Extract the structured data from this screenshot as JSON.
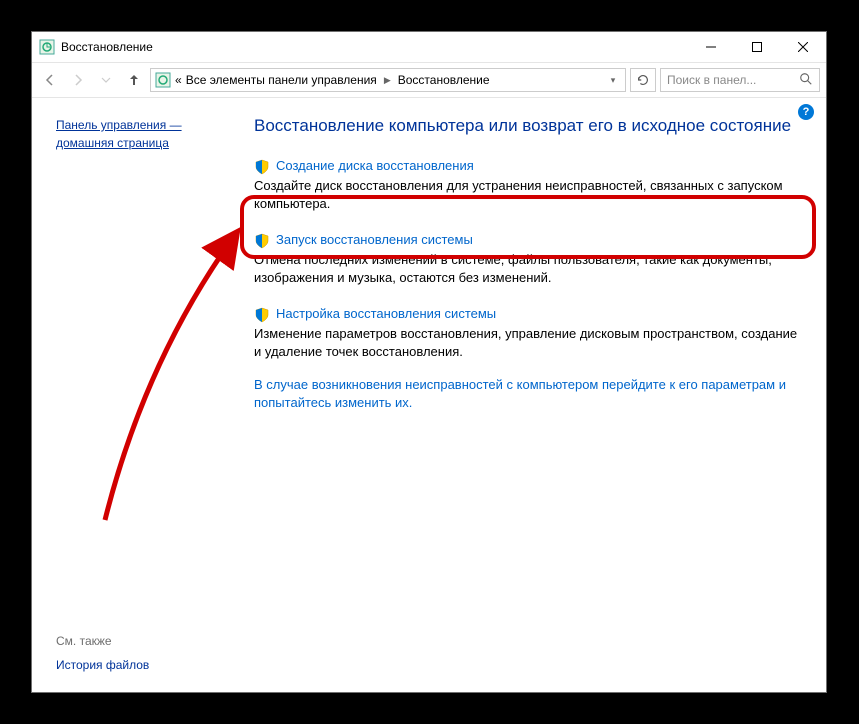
{
  "window": {
    "title": "Восстановление"
  },
  "address": {
    "prefix": "«",
    "seg1": "Все элементы панели управления",
    "seg2": "Восстановление"
  },
  "search": {
    "placeholder": "Поиск в панел..."
  },
  "sidebar": {
    "home_line1": "Панель управления —",
    "home_line2": "домашняя страница",
    "see_also": "См. также",
    "file_history": "История файлов"
  },
  "main": {
    "heading": "Восстановление компьютера или возврат его в исходное состояние",
    "options": [
      {
        "title": "Создание диска восстановления",
        "desc": "Создайте диск восстановления для устранения неисправностей, связанных с запуском компьютера."
      },
      {
        "title": "Запуск восстановления системы",
        "desc": "Отмена последних изменений в системе; файлы пользователя, такие как документы, изображения и музыка, остаются без изменений."
      },
      {
        "title": "Настройка восстановления системы",
        "desc": "Изменение параметров восстановления, управление дисковым пространством, создание и удаление точек восстановления."
      }
    ],
    "prompt": "В случае возникновения неисправностей с компьютером перейдите к его параметрам и попытайтесь изменить их."
  }
}
